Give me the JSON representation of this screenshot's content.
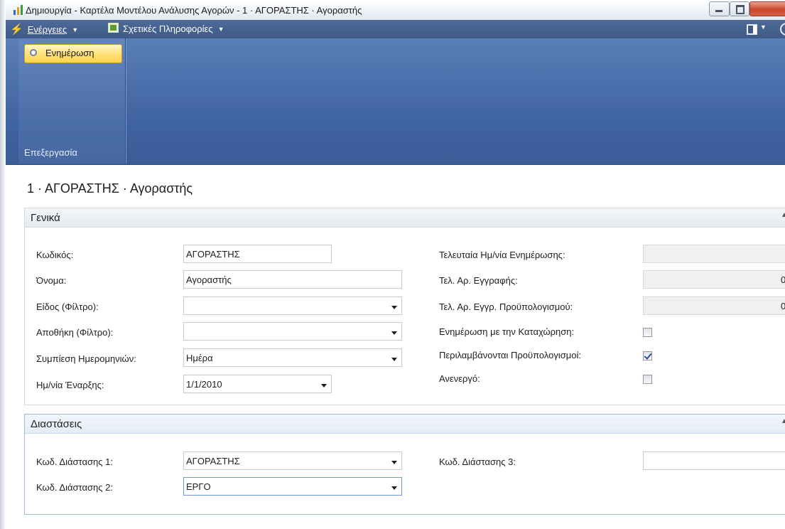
{
  "window": {
    "title": "Δημιουργία - Καρτέλα Μοντέλου Ανάλυσης Αγορών - 1 · ΑΓΟΡΑΣΤΗΣ · Αγοραστής"
  },
  "menubar": {
    "actions_label": "Ενέργειες",
    "related_info_label": "Σχετικές Πληροφορίες"
  },
  "ribbon": {
    "refresh_label": "Ενημέρωση",
    "group_label": "Επεξεργασία"
  },
  "page": {
    "title": "1 · ΑΓΟΡΑΣΤΗΣ · Αγοραστής"
  },
  "general": {
    "header": "Γενικά",
    "code": {
      "label": "Κωδικός:",
      "value": "ΑΓΟΡΑΣΤΗΣ"
    },
    "name": {
      "label": "Όνομα:",
      "value": "Αγοραστής"
    },
    "item_filter": {
      "label": "Είδος (Φίλτρο):",
      "value": ""
    },
    "location_filter": {
      "label": "Αποθήκη (Φίλτρο):",
      "value": ""
    },
    "date_compression": {
      "label": "Συμπίεση Ημερομηνιών:",
      "value": "Ημέρα"
    },
    "starting_date": {
      "label": "Ημ/νία Έναρξης:",
      "value": "1/1/2010"
    },
    "last_date_updated": {
      "label": "Τελευταία Ημ/νία Ενημέρωσης:",
      "value": ""
    },
    "last_entry_no": {
      "label": "Τελ. Αρ. Εγγραφής:",
      "value": "0"
    },
    "last_budget_entry_no": {
      "label": "Τελ. Αρ. Εγγρ. Προϋπολογισμού:",
      "value": "0"
    },
    "update_on_posting": {
      "label": "Ενημέρωση με την Καταχώρηση:",
      "checked": false
    },
    "include_budgets": {
      "label": "Περιλαμβάνονται Προϋπολογισμοί:",
      "checked": true
    },
    "blocked": {
      "label": "Ανενεργό:",
      "checked": false
    }
  },
  "dimensions": {
    "header": "Διαστάσεις",
    "dim1": {
      "label": "Κωδ. Διάστασης 1:",
      "value": "ΑΓΟΡΑΣΤΗΣ"
    },
    "dim2": {
      "label": "Κωδ. Διάστασης 2:",
      "value": "ΕΡΓΟ"
    },
    "dim3": {
      "label": "Κωδ. Διάστασης 3:",
      "value": ""
    }
  },
  "icons": [
    "app-icon",
    "lightning-icon",
    "info-icon",
    "refresh-icon",
    "chevron-down-icon",
    "collapse-icon"
  ],
  "colors": {
    "ribbon": "#4b6ea9",
    "menubar": "#3e5a87",
    "refresh_button": "#ffe27c"
  }
}
